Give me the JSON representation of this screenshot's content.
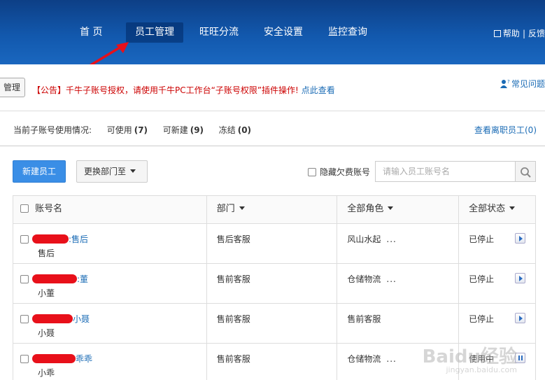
{
  "header": {
    "nav": [
      "首 页",
      "员工管理",
      "旺旺分流",
      "安全设置",
      "监控查询"
    ],
    "active_nav": "员工管理",
    "right": {
      "help": "帮助",
      "sep": "|",
      "feedback": "反馈"
    }
  },
  "notice": {
    "manage_button": "管理",
    "text": "【公告】千牛子账号授权，请使用千牛PC工作台“子账号权限”插件操作!",
    "link": "点此查看",
    "faq": "常见问题"
  },
  "usage": {
    "label": "当前子账号使用情况:",
    "available_label": "可使用",
    "available": "(7)",
    "creatable_label": "可新建",
    "creatable": "(9)",
    "frozen_label": "冻结",
    "frozen": "(0)",
    "view_left": "查看离职员工(0)"
  },
  "toolbar": {
    "new_employee": "新建员工",
    "change_dept": "更换部门至",
    "hide_arrears": "隐藏欠费账号",
    "search_placeholder": "请输入员工账号名"
  },
  "table": {
    "headers": {
      "account": "账号名",
      "department": "部门",
      "role": "全部角色",
      "status": "全部状态"
    },
    "rows": [
      {
        "account_suffix": ":售后",
        "name": "售后",
        "department": "售后客服",
        "role": "风山水起",
        "more": "...",
        "status": "已停止",
        "action": "play"
      },
      {
        "account_suffix": ":董",
        "name": "小董",
        "department": "售前客服",
        "role": "仓储物流",
        "more": "...",
        "status": "已停止",
        "action": "play"
      },
      {
        "account_suffix": "小聂",
        "name": "小聂",
        "department": "售前客服",
        "role": "售前客服",
        "more": "",
        "status": "已停止",
        "action": "play"
      },
      {
        "account_suffix": "乖乖",
        "name": "小乖",
        "department": "售前客服",
        "role": "仓储物流",
        "more": "...",
        "status": "使用中",
        "action": "pause"
      }
    ]
  },
  "colors": {
    "header_bg": "#1258ad",
    "accent": "#3a8ee6",
    "link": "#1a6bb5",
    "notice_red": "#cc0000",
    "redaction": "#e8101a"
  },
  "watermark": {
    "brand": "Baidu经验",
    "url": "jingyan.baidu.com"
  }
}
